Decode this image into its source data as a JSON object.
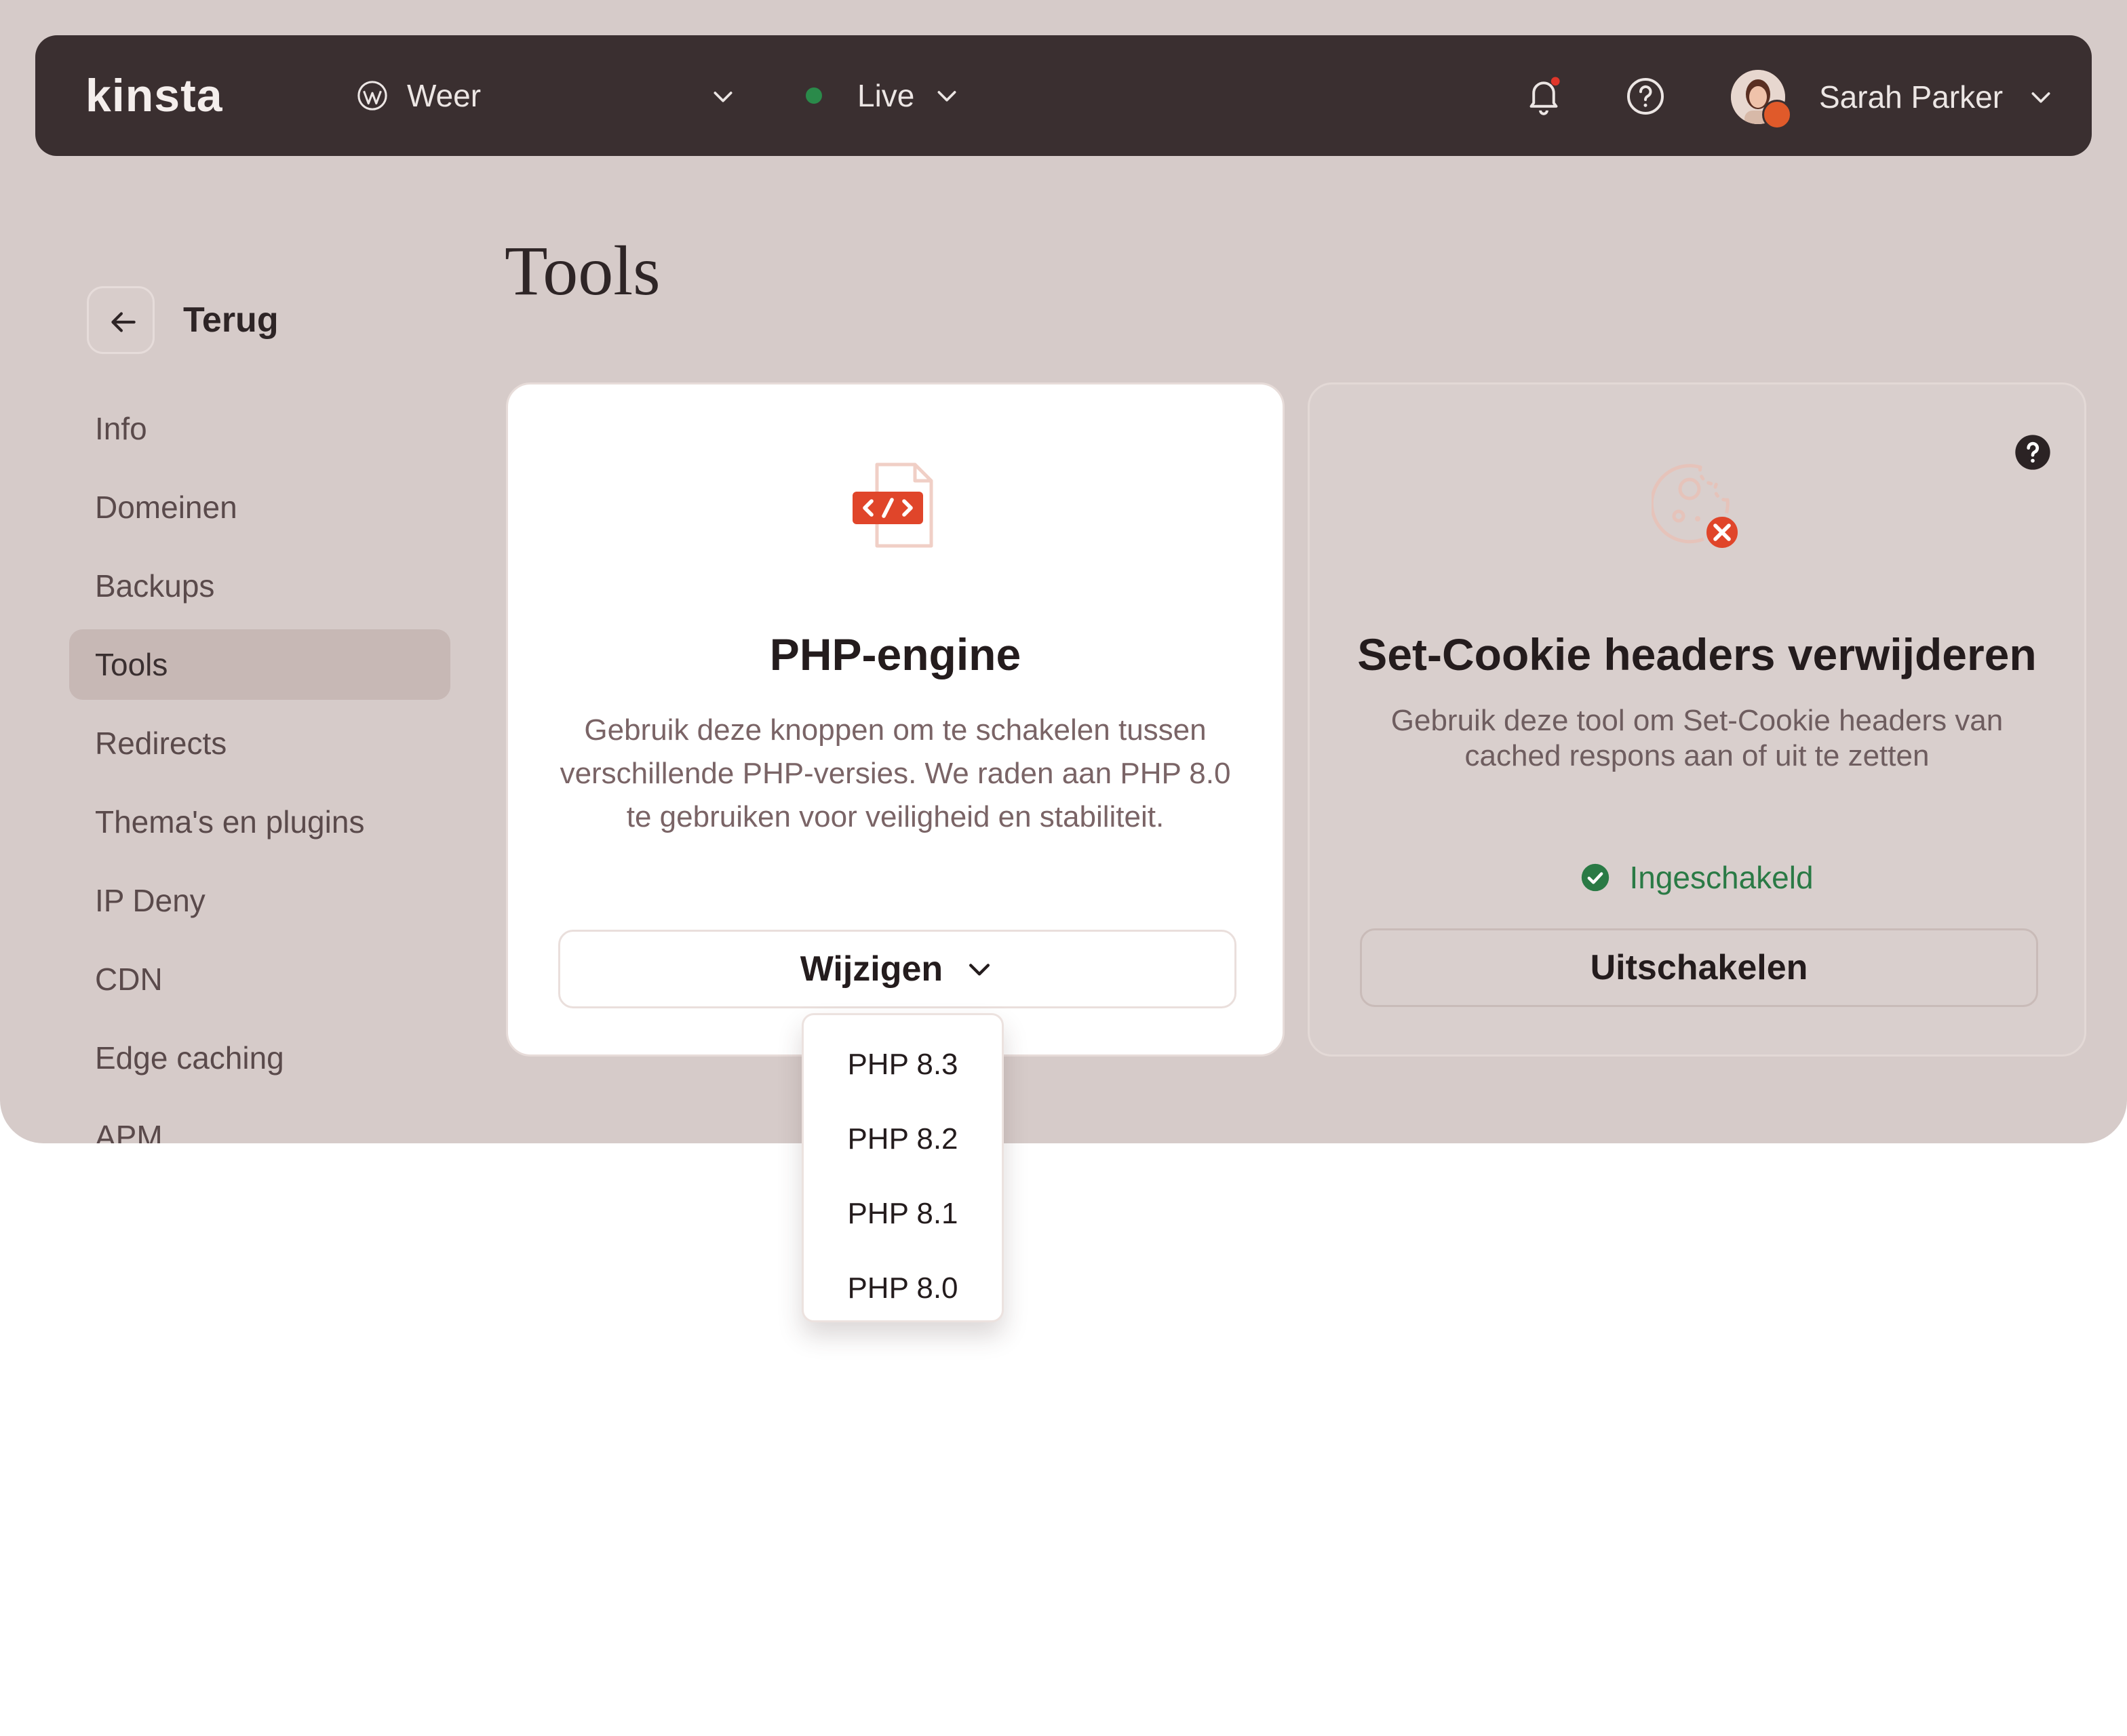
{
  "topbar": {
    "logo": "kinsta",
    "site": {
      "name": "Weer",
      "icon": "wordpress-icon"
    },
    "environment": {
      "label": "Live",
      "status_color": "#2a8a4a"
    },
    "notifications": {
      "icon": "bell-icon",
      "has_unread": true
    },
    "help": {
      "icon": "help-icon"
    },
    "user": {
      "name": "Sarah Parker"
    }
  },
  "sidebar": {
    "back_label": "Terug",
    "items": [
      {
        "label": "Info"
      },
      {
        "label": "Domeinen"
      },
      {
        "label": "Backups"
      },
      {
        "label": "Tools",
        "active": true
      },
      {
        "label": "Redirects"
      },
      {
        "label": "Thema's en plugins"
      },
      {
        "label": "IP Deny"
      },
      {
        "label": "CDN"
      },
      {
        "label": "Edge caching"
      },
      {
        "label": "APM"
      }
    ]
  },
  "page": {
    "title": "Tools"
  },
  "cards": {
    "php": {
      "title": "PHP-engine",
      "description": "Gebruik deze knoppen om te schakelen tussen verschillende PHP-versies. We raden aan PHP 8.0 te gebruiken voor veiligheid en stabiliteit.",
      "button_label": "Wijzigen",
      "icon": "code-file-icon",
      "dropdown_options": [
        "PHP 8.3",
        "PHP 8.2",
        "PHP 8.1",
        "PHP 8.0"
      ]
    },
    "cookie": {
      "title": "Set-Cookie headers verwijderen",
      "description": "Gebruik deze tool om Set-Cookie headers van cached respons aan of uit te zetten",
      "status": "Ingeschakeld",
      "button_label": "Uitschakelen",
      "icon": "cookie-icon"
    }
  },
  "colors": {
    "topbar_bg": "#3a2f30",
    "app_bg": "#d6cbc9",
    "accent": "#e0452a",
    "success": "#2a7a45"
  }
}
